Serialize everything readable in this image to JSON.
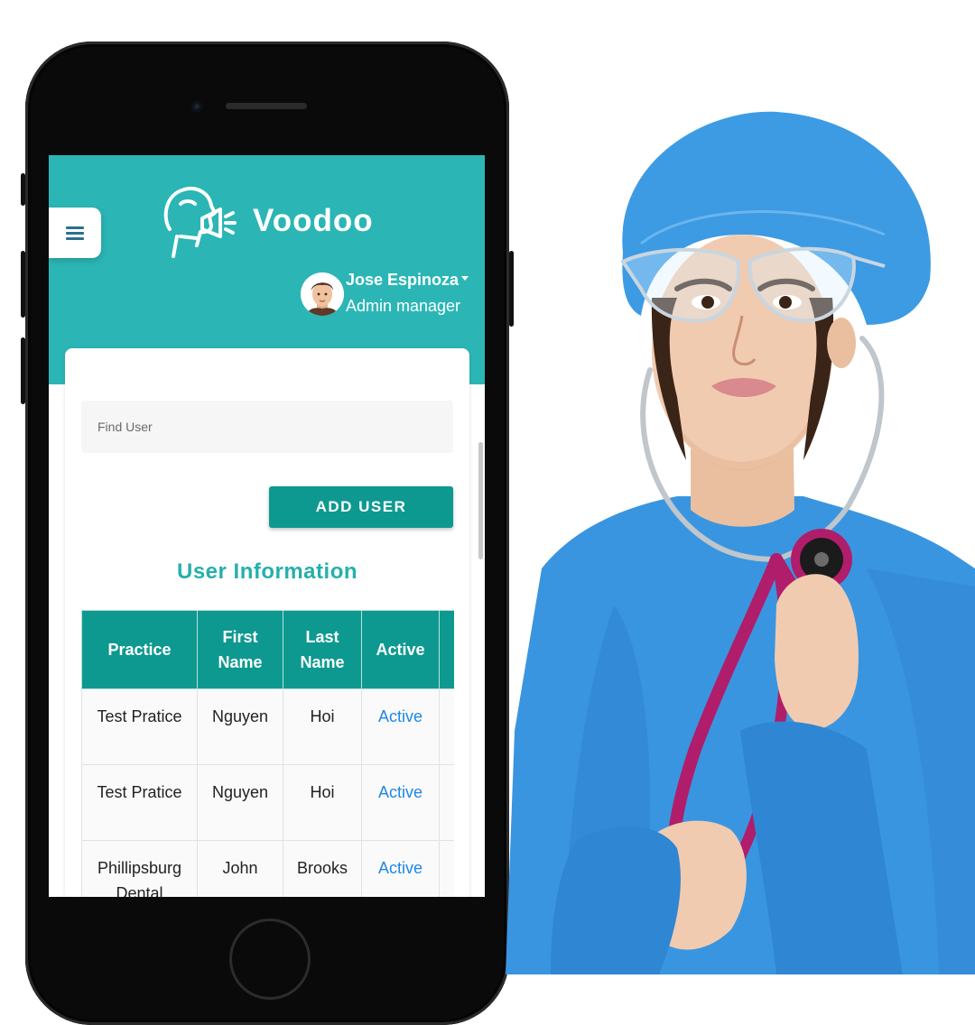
{
  "app": {
    "name": "Voodoo",
    "user": {
      "name": "Jose Espinoza",
      "role": "Admin manager"
    }
  },
  "search": {
    "placeholder": "Find User",
    "value": ""
  },
  "actions": {
    "add_user_label": "ADD USER"
  },
  "section_title": "User Information",
  "table": {
    "headers": [
      "Practice",
      "First Name",
      "Last Name",
      "Active"
    ],
    "rows": [
      {
        "practice": "Test Pratice",
        "first_name": "Nguyen",
        "last_name": "Hoi",
        "active": "Active"
      },
      {
        "practice": "Test Pratice",
        "first_name": "Nguyen",
        "last_name": "Hoi",
        "active": "Active"
      },
      {
        "practice": "Phillipsburg Dental Associates",
        "first_name": "John",
        "last_name": "Brooks",
        "active": "Active"
      }
    ]
  },
  "colors": {
    "brand_teal": "#2bb6b5",
    "button_teal": "#0e9990",
    "title_teal": "#25b0ac",
    "link_blue": "#1e88e5"
  },
  "icons": {
    "menu": "hamburger-icon",
    "logo": "speaking-head-icon",
    "dropdown": "caret-down-icon",
    "avatar": "user-avatar"
  }
}
